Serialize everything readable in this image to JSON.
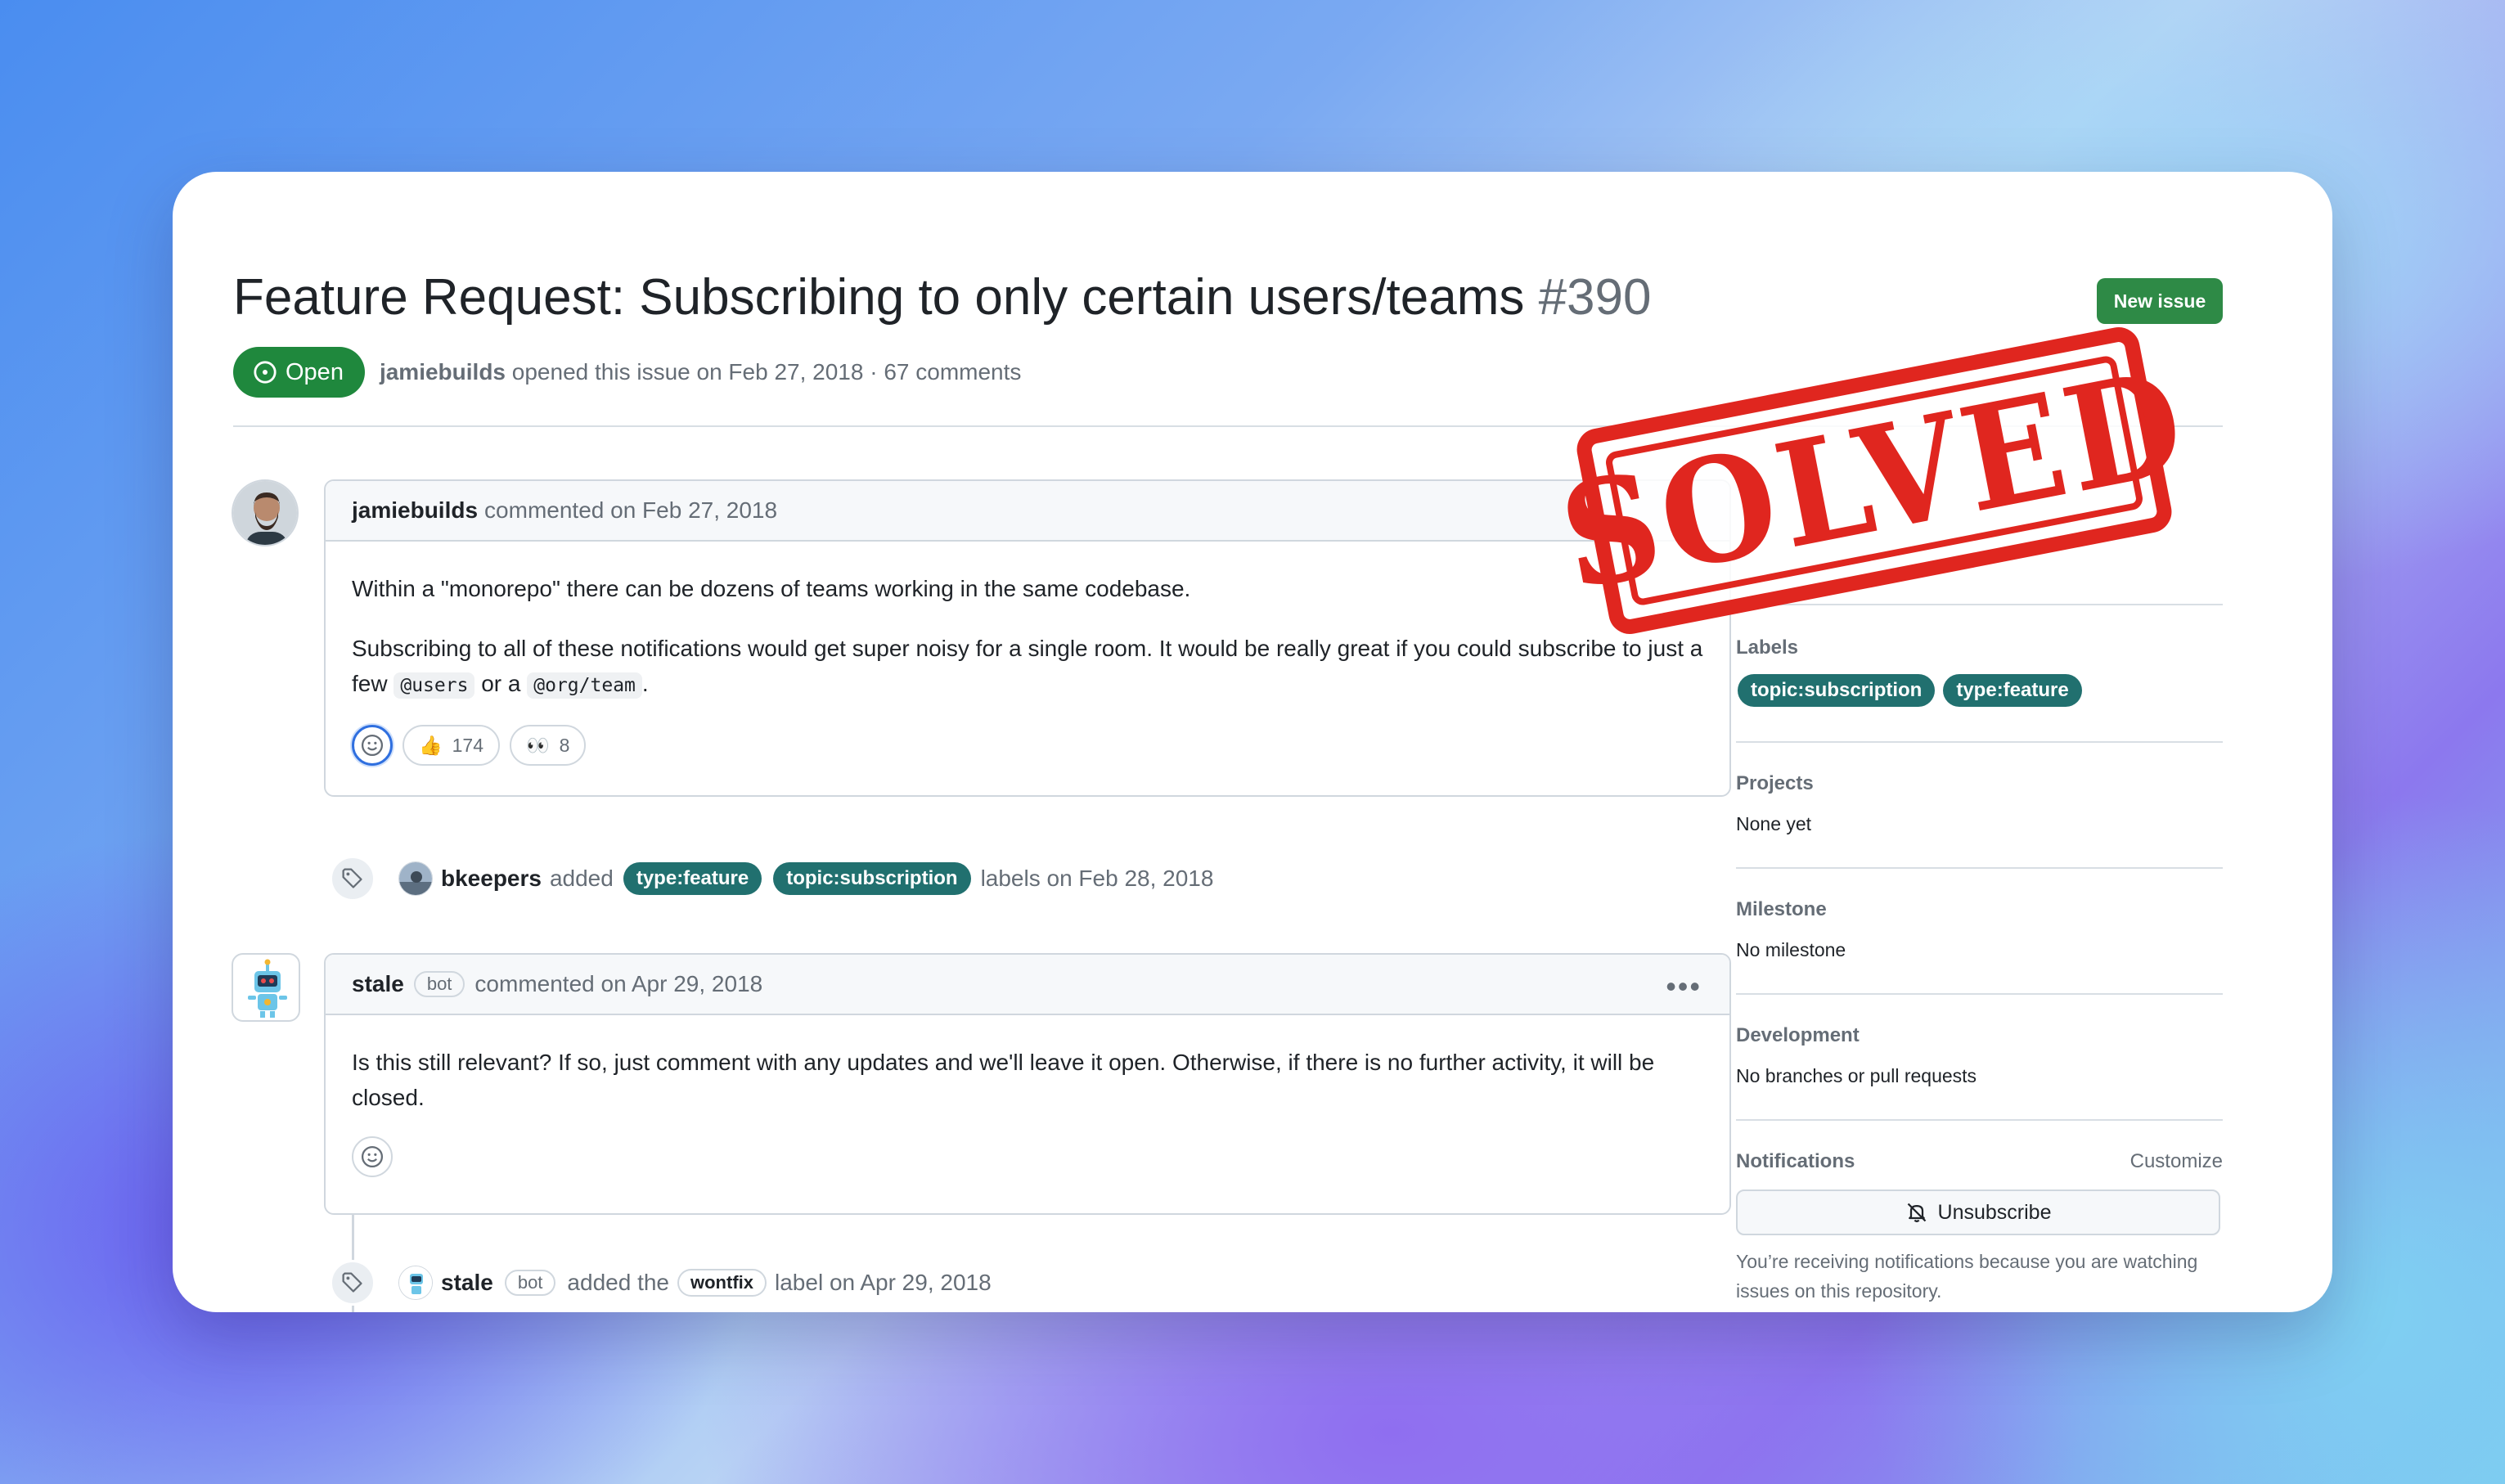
{
  "issue": {
    "title": "Feature Request: Subscribing to only certain users/teams",
    "number": "#390",
    "status": "Open",
    "author": "jamiebuilds",
    "opened_text": "opened this issue on Feb 27, 2018 · 67 comments",
    "new_issue_label": "New issue"
  },
  "comments": [
    {
      "author": "jamiebuilds",
      "date_text": "commented on Feb 27, 2018",
      "para1": "Within a \"monorepo\" there can be dozens of teams working in the same codebase.",
      "para2_a": "Subscribing to all of these notifications would get super noisy for a single room. It would be really great if you could subscribe to just a few",
      "code1": "@users",
      "para2_b": "or a",
      "code2": "@org/team",
      "para2_c": ".",
      "reactions": [
        {
          "emoji": "👍",
          "count": "174"
        },
        {
          "emoji": "👀",
          "count": "8"
        }
      ]
    },
    {
      "author": "stale",
      "bot_tag": "bot",
      "date_text": "commented on Apr 29, 2018",
      "body": "Is this still relevant? If so, just comment with any updates and we'll leave it open. Otherwise, if there is no further activity, it will be closed."
    }
  ],
  "events": [
    {
      "actor": "bkeepers",
      "action": "added",
      "labels": [
        "type:feature",
        "topic:subscription"
      ],
      "suffix": "labels on Feb 28, 2018"
    },
    {
      "actor": "stale",
      "bot_tag": "bot",
      "action": "added the",
      "label": "wontfix",
      "suffix": "label on Apr 29, 2018"
    }
  ],
  "sidebar": {
    "labels_heading": "Labels",
    "labels": [
      "topic:subscription",
      "type:feature"
    ],
    "projects_heading": "Projects",
    "projects_value": "None yet",
    "milestone_heading": "Milestone",
    "milestone_value": "No milestone",
    "development_heading": "Development",
    "development_value": "No branches or pull requests",
    "notifications_heading": "Notifications",
    "customize_label": "Customize",
    "unsubscribe_label": "Unsubscribe",
    "notifications_note": "You’re receiving notifications because you are watching issues on this repository."
  },
  "stamp_text": "SOLVED",
  "colors": {
    "open_green": "#1f883d",
    "label_teal": "#21706f",
    "stamp_red": "#e0261f"
  }
}
